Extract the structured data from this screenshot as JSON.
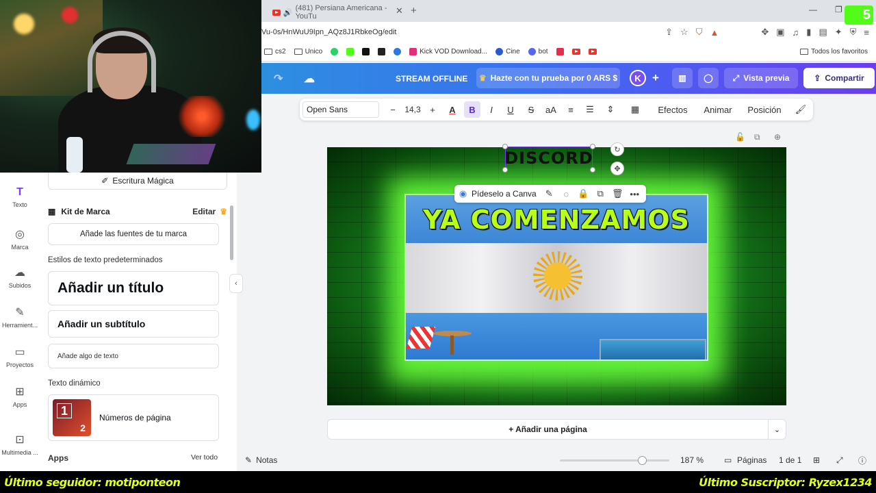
{
  "browser": {
    "tab_title": "(481) Persiana Americana - YouTu",
    "url": "Vu-0s/HnWuU9Ipn_AQz8J1RbkeOg/edit",
    "extension_badge": "5",
    "bookmarks": [
      {
        "label": "cs2",
        "icon": "folder-icon"
      },
      {
        "label": "Unico",
        "icon": "folder-icon"
      },
      {
        "label": "",
        "icon": "whatsapp-icon"
      },
      {
        "label": "",
        "icon": "kick-icon"
      },
      {
        "label": "",
        "icon": "tiktok-icon"
      },
      {
        "label": "",
        "icon": "app-icon"
      },
      {
        "label": "",
        "icon": "chrome-icon"
      },
      {
        "label": "Kick VOD Download...",
        "icon": "kick-vod-icon"
      },
      {
        "label": "Cine",
        "icon": "cine-icon"
      },
      {
        "label": "bot",
        "icon": "discord-icon"
      }
    ],
    "all_bookmarks": "Todos los favoritos"
  },
  "header": {
    "status": "STREAM OFFLINE",
    "promo": "Hazte con tu prueba por 0 ARS $",
    "avatar_initial": "K",
    "preview": "Vista previa",
    "share": "Compartir"
  },
  "toolbar": {
    "font": "Open Sans",
    "size": "14,3",
    "bold": "B",
    "italic": "I",
    "underline": "U",
    "strike": "S",
    "case": "aA",
    "effects": "Efectos",
    "animate": "Animar",
    "position": "Posición"
  },
  "rail": [
    {
      "label": "Texto",
      "icon": "text-icon"
    },
    {
      "label": "Marca",
      "icon": "brand-icon"
    },
    {
      "label": "Subidos",
      "icon": "upload-icon"
    },
    {
      "label": "Herramient...",
      "icon": "tools-icon"
    },
    {
      "label": "Proyectos",
      "icon": "folder-icon"
    },
    {
      "label": "Apps",
      "icon": "apps-icon"
    },
    {
      "label": "Multimedia ...",
      "icon": "media-icon"
    }
  ],
  "panel": {
    "magic_write": "Escritura Mágica",
    "brand_kit": "Kit de Marca",
    "edit": "Editar",
    "add_brand_fonts": "Añade las fuentes de tu marca",
    "default_styles": "Estilos de texto predeterminados",
    "add_title": "Añadir un título",
    "add_subtitle": "Añadir un subtítulo",
    "add_body": "Añade algo de texto",
    "dynamic_text": "Texto dinámico",
    "page_numbers": "Números de página",
    "page_badge_1": "1",
    "page_badge_2": "2",
    "apps": "Apps",
    "see_all": "Ver todo"
  },
  "canvas": {
    "headline": "YA COMENZAMOS",
    "selected_text": "DISCORD",
    "ask_canva": "Pídeselo a Canva"
  },
  "add_page": "+ Añadir una página",
  "footer": {
    "notes": "Notas",
    "zoom": "187 %",
    "zoom_fraction": 0.71,
    "pages": "Páginas",
    "page_of": "1 de 1"
  },
  "stream_bar": {
    "last_follower": "Último seguidor: motiponteon",
    "last_subscriber": "Último Suscriptor: Ryzex1234"
  },
  "colors": {
    "accent": "#7a3df0",
    "headline": "#b7ff1a",
    "overlay_text": "#dfff1a"
  }
}
